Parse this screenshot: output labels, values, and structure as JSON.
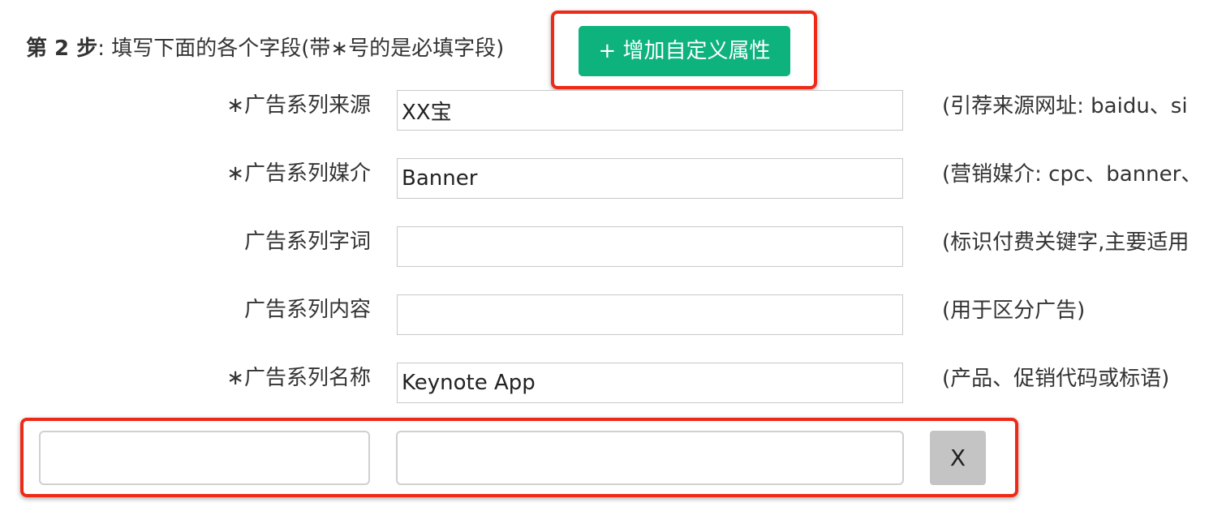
{
  "step": {
    "label": "第 2 步",
    "instruction": ":  填写下面的各个字段(带∗号的是必填字段)"
  },
  "add_custom_button": {
    "label": "+ 增加自定义属性"
  },
  "fields": [
    {
      "label": "∗广告系列来源",
      "value": "XX宝",
      "hint": "(引荐来源网址: baidu、si"
    },
    {
      "label": "∗广告系列媒介",
      "value": "Banner",
      "hint": "(营销媒介: cpc、banner、"
    },
    {
      "label": "广告系列字词",
      "value": "",
      "hint": "(标识付费关键字,主要适用"
    },
    {
      "label": "广告系列内容",
      "value": "",
      "hint": "(用于区分广告)"
    },
    {
      "label": "∗广告系列名称",
      "value": "Keynote App",
      "hint": "(产品、促销代码或标语)"
    }
  ],
  "custom_attribute": {
    "name_value": "",
    "value_value": "",
    "remove_label": "X"
  },
  "colors": {
    "accent_green": "#0db27d",
    "highlight_red": "#ee2a17",
    "remove_gray": "#c4c4c4"
  }
}
